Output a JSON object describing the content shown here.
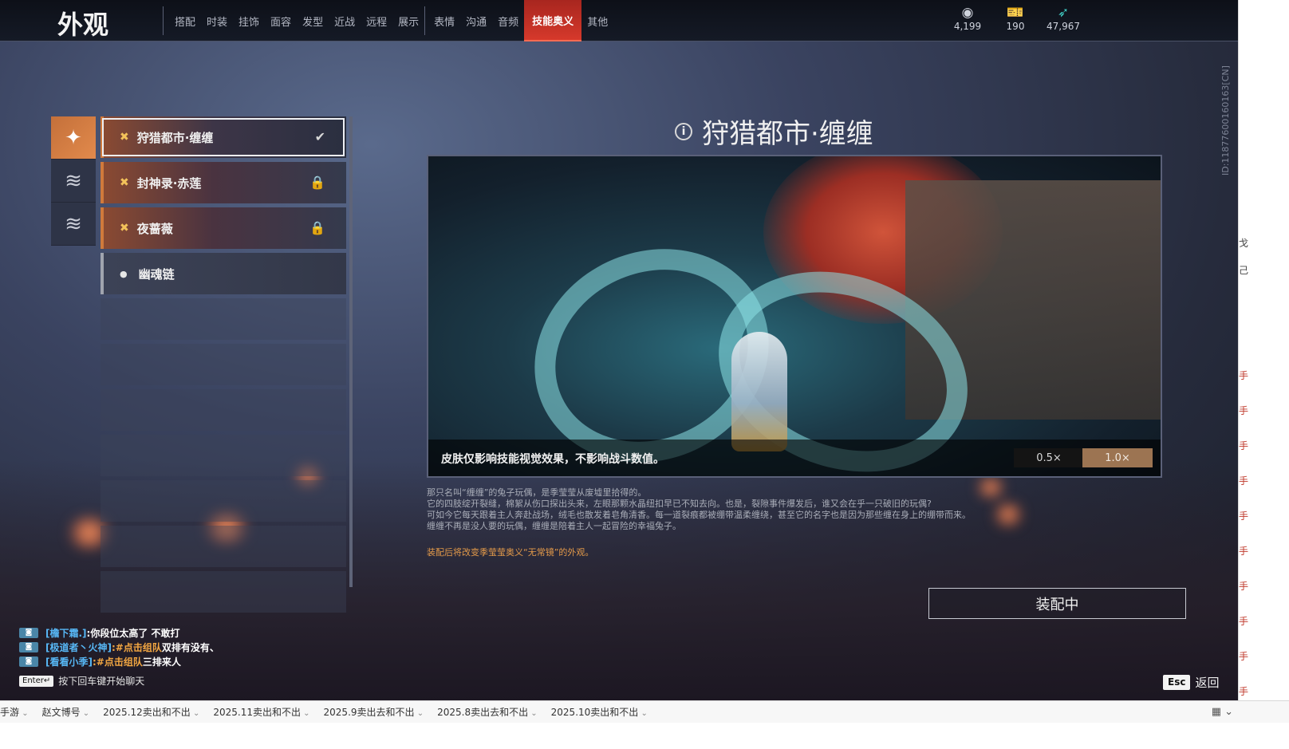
{
  "app_title": "外观",
  "tabs": [
    {
      "label": "搭配",
      "active": false
    },
    {
      "label": "时装",
      "active": false
    },
    {
      "label": "挂饰",
      "active": false
    },
    {
      "label": "面容",
      "active": false
    },
    {
      "label": "发型",
      "active": false
    },
    {
      "label": "近战",
      "active": false
    },
    {
      "label": "远程",
      "active": false
    },
    {
      "label": "展示",
      "active": false
    },
    {
      "label": "表情",
      "active": false
    },
    {
      "label": "沟通",
      "active": false
    },
    {
      "label": "音频",
      "active": false
    },
    {
      "label": "技能奥义",
      "active": true
    },
    {
      "label": "其他",
      "active": false
    }
  ],
  "currencies": [
    {
      "icon": "coin-icon",
      "value": "4,199"
    },
    {
      "icon": "ticket-icon",
      "value": "190"
    },
    {
      "icon": "feather-icon",
      "value": "47,967"
    }
  ],
  "vertical_id": "ID:11877600160163[CN]",
  "items": [
    {
      "label": "狩猎都市·缠缠",
      "status": "✔",
      "status_icon": "check-icon",
      "selected": true
    },
    {
      "label": "封神录·赤莲",
      "status": "🔒",
      "status_icon": "lock-icon",
      "selected": false
    },
    {
      "label": "夜蔷薇",
      "status": "🔒",
      "status_icon": "lock-icon",
      "selected": false
    },
    {
      "label": "幽魂链",
      "status": "",
      "status_icon": "",
      "selected": false
    }
  ],
  "skin_title": "狩猎都市·缠缠",
  "preview": {
    "disclaimer": "皮肤仅影响技能视觉效果，不影响战斗数值。",
    "speed_options": [
      "0.5×",
      "1.0×"
    ],
    "speed_selected": "1.0×"
  },
  "description": [
    "那只名叫“缠缠”的兔子玩偶，是季莹莹从废墟里拾得的。",
    "它的四肢绽开裂缝，棉絮从伤口探出头来，左眼那颗水晶纽扣早已不知去向。也是，裂隙事件爆发后，谁又会在乎一只破旧的玩偶?",
    "可如今它每天跟着主人奔赴战场，绒毛也散发着皂角清香。每一道裂痕都被绷带温柔缠绕，甚至它的名字也是因为那些缠在身上的绷带而来。",
    "缠缠不再是没人要的玩偶，缠缠是陪着主人一起冒险的幸福兔子。"
  ],
  "equip_note": "装配后将改变季莹莹奥义“无常镜”的外观。",
  "equip_button": "装配中",
  "chat": [
    {
      "name": "[檐下霜.]",
      "text": ":你段位太高了 不敢打",
      "link": ""
    },
    {
      "name": "[极道者丶火神]",
      "text": " 双排有没有、",
      "link": ":#点击组队"
    },
    {
      "name": "[看看小季]",
      "text": " 三排来人",
      "link": ":#点击组队"
    }
  ],
  "chat_key": "Enter↵",
  "chat_hint": "按下回车键开始聊天",
  "esc_key": "Esc",
  "back_label": "返回",
  "taskbar": [
    "手游",
    "赵文博号",
    "2025.12卖出和不出",
    "2025.11卖出和不出",
    "2025.9卖出去和不出",
    "2025.8卖出去和不出",
    "2025.10卖出和不出"
  ],
  "right_strip": [
    "戈",
    "己",
    "手",
    "手",
    "手",
    "手",
    "手",
    "手",
    "手",
    "手",
    "手",
    "手"
  ]
}
